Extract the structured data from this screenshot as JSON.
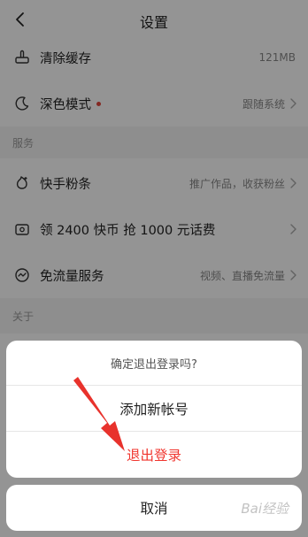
{
  "header": {
    "title": "设置"
  },
  "settings": {
    "clear_cache": {
      "label": "清除缓存",
      "value": "121MB",
      "icon": "broom-icon"
    },
    "dark_mode": {
      "label": "深色模式",
      "value": "跟随系统",
      "icon": "moon-icon",
      "dot_color": "#e2453b"
    }
  },
  "services_section": {
    "title": "服务",
    "items": [
      {
        "label": "快手粉条",
        "value": "推广作品，收获粉丝",
        "icon": "fan-boost-icon"
      },
      {
        "label": "领 2400 快币 抢 1000 元话费",
        "value": "",
        "icon": "wallet-icon"
      },
      {
        "label": "免流量服务",
        "value": "视频、直播免流量",
        "icon": "free-data-icon"
      }
    ]
  },
  "about_section": {
    "title": "关于"
  },
  "dialog": {
    "prompt": "确定退出登录吗?",
    "add_account_label": "添加新帐号",
    "logout_label": "退出登录",
    "cancel_label": "取消",
    "logout_color": "#f0352e"
  },
  "annotation": {
    "arrow_color": "#e8322c"
  },
  "watermark": {
    "text": "Bai经验"
  }
}
